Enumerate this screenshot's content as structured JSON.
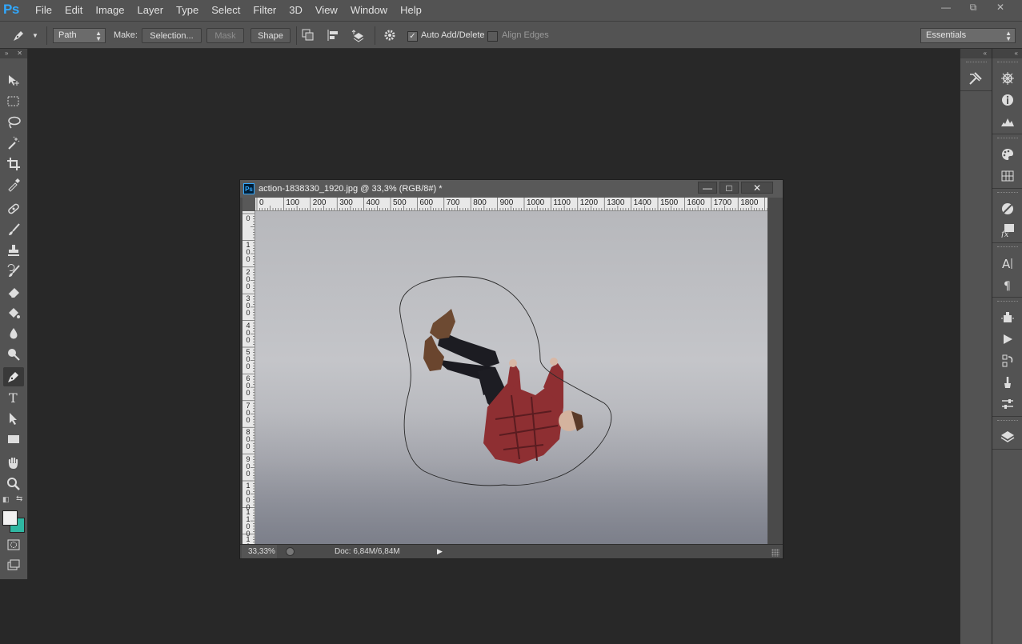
{
  "app": {
    "logo": "Ps"
  },
  "menu": [
    "File",
    "Edit",
    "Image",
    "Layer",
    "Type",
    "Select",
    "Filter",
    "3D",
    "View",
    "Window",
    "Help"
  ],
  "window_controls": {
    "minimize": "—",
    "restore": "⧉",
    "close": "✕"
  },
  "options": {
    "mode": "Path",
    "make_label": "Make:",
    "selection_button": "Selection...",
    "mask_button": "Mask",
    "shape_button": "Shape",
    "auto_add_delete": {
      "label": "Auto Add/Delete",
      "checked": true
    },
    "align_edges": {
      "label": "Align Edges",
      "checked": false
    },
    "workspace": "Essentials"
  },
  "tools": [
    "move-tool",
    "rectangular-marquee-tool",
    "lasso-tool",
    "magic-wand-tool",
    "crop-tool",
    "eyedropper-tool",
    "spot-healing-tool",
    "brush-tool",
    "clone-stamp-tool",
    "history-brush-tool",
    "eraser-tool",
    "paint-bucket-tool",
    "blur-tool",
    "dodge-tool",
    "pen-tool",
    "type-tool",
    "path-selection-tool",
    "rectangle-tool",
    "hand-tool",
    "zoom-tool"
  ],
  "active_tool": "pen-tool",
  "colors": {
    "foreground": "#f1f1f1",
    "background": "#2fb7a2",
    "accent": "#31a8ff"
  },
  "document": {
    "title": "action-1838330_1920.jpg @ 33,3% (RGB/8#) *",
    "ps_badge": "Ps",
    "controls": {
      "minimize": "—",
      "maximize": "□",
      "close": "✕"
    },
    "ruler_top": [
      "0",
      "100",
      "200",
      "300",
      "400",
      "500",
      "600",
      "700",
      "800",
      "900",
      "1000",
      "1100",
      "1200",
      "1300",
      "1400",
      "1500",
      "1600",
      "1700",
      "1800"
    ],
    "ruler_left": [
      "0",
      "100",
      "200",
      "300",
      "400",
      "500",
      "600",
      "700",
      "800",
      "900",
      "1000",
      "1100",
      "12"
    ],
    "zoom": "33,33%",
    "doc_info": "Doc: 6,84M/6,84M",
    "status_arrow": "▶"
  }
}
